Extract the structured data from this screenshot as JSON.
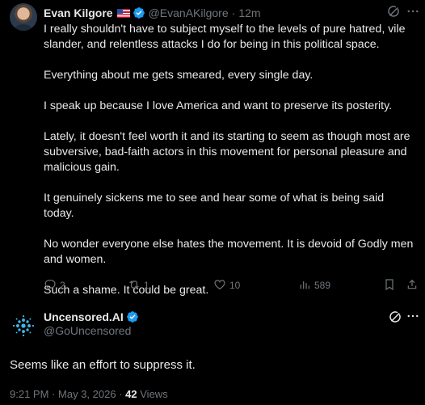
{
  "tweet": {
    "name": "Evan Kilgore",
    "handle": "@EvanAKilgore",
    "separator": "·",
    "time": "12m",
    "paragraphs": [
      "I really shouldn't have to subject myself to the levels of pure hatred, vile slander, and relentless attacks I do for being in this political space.",
      "Everything about me gets smeared, every single day.",
      "I speak up because I love America and want to preserve its posterity.",
      "Lately, it doesn't feel worth it and its starting to seem as though most are subversive, bad-faith actors in this movement for personal pleasure and malicious gain.",
      "It genuinely sickens me to see and hear some of what is being said today.",
      "No wonder everyone else hates the movement. It is devoid of Godly men and women.",
      "Such a shame. It could be great."
    ],
    "stats": {
      "replies": "2",
      "reposts": "1",
      "likes": "10",
      "views": "589"
    }
  },
  "reply": {
    "name": "Uncensored.AI",
    "handle": "@GoUncensored",
    "text": "Seems like an effort to suppress it.",
    "time": "9:21 PM",
    "date": "May 3, 2026",
    "separator": "·",
    "views_count": "42",
    "views_label": "Views"
  },
  "colors": {
    "background": "#000000",
    "text": "#e7e9ea",
    "muted": "#71767b",
    "verified": "#1d9bf0"
  },
  "icons": [
    "flag-icon",
    "verified-icon",
    "grok-icon",
    "more-icon",
    "reply-icon",
    "repost-icon",
    "like-icon",
    "views-icon",
    "bookmark-icon",
    "share-icon"
  ]
}
